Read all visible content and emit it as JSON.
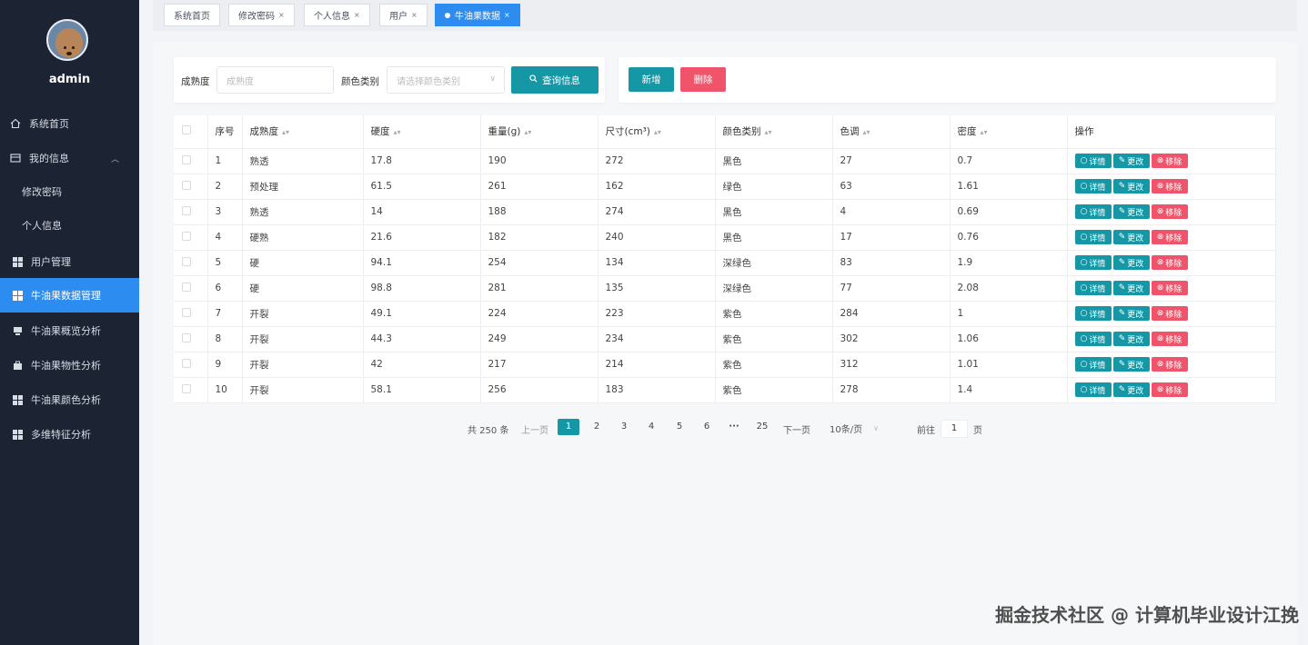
{
  "sidebar": {
    "username": "admin",
    "items": [
      {
        "label": "系统首页",
        "icon": "home-icon"
      },
      {
        "label": "我的信息",
        "icon": "profile-icon"
      },
      {
        "label": "修改密码"
      },
      {
        "label": "个人信息"
      },
      {
        "label": "用户管理",
        "icon": "grid-icon"
      },
      {
        "label": "牛油果数据管理",
        "icon": "grid-icon"
      },
      {
        "label": "牛油果概览分析",
        "icon": "chart-icon"
      },
      {
        "label": "牛油果物性分析",
        "icon": "briefcase-icon"
      },
      {
        "label": "牛油果颜色分析",
        "icon": "grid-icon"
      },
      {
        "label": "多维特征分析",
        "icon": "grid-icon"
      }
    ]
  },
  "tabs": [
    "系统首页",
    "修改密码",
    "个人信息",
    "用户",
    "牛油果数据"
  ],
  "search": {
    "ripeness_label": "成熟度",
    "ripeness_placeholder": "成熟度",
    "color_label": "颜色类别",
    "color_placeholder": "请选择颜色类别",
    "query_button": "查询信息"
  },
  "actions": {
    "add": "新增",
    "delete": "删除"
  },
  "table": {
    "headers": [
      "序号",
      "成熟度",
      "硬度",
      "重量(g)",
      "尺寸(cm³)",
      "颜色类别",
      "色调",
      "密度",
      "操作"
    ],
    "action_labels": {
      "view": "详情",
      "edit": "更改",
      "remove": "移除"
    },
    "rows": [
      [
        "1",
        "熟透",
        "17.8",
        "190",
        "272",
        "黑色",
        "27",
        "0.7"
      ],
      [
        "2",
        "预处理",
        "61.5",
        "261",
        "162",
        "绿色",
        "63",
        "1.61"
      ],
      [
        "3",
        "熟透",
        "14",
        "188",
        "274",
        "黑色",
        "4",
        "0.69"
      ],
      [
        "4",
        "硬熟",
        "21.6",
        "182",
        "240",
        "黑色",
        "17",
        "0.76"
      ],
      [
        "5",
        "硬",
        "94.1",
        "254",
        "134",
        "深绿色",
        "83",
        "1.9"
      ],
      [
        "6",
        "硬",
        "98.8",
        "281",
        "135",
        "深绿色",
        "77",
        "2.08"
      ],
      [
        "7",
        "开裂",
        "49.1",
        "224",
        "223",
        "紫色",
        "284",
        "1"
      ],
      [
        "8",
        "开裂",
        "44.3",
        "249",
        "234",
        "紫色",
        "302",
        "1.06"
      ],
      [
        "9",
        "开裂",
        "42",
        "217",
        "214",
        "紫色",
        "312",
        "1.01"
      ],
      [
        "10",
        "开裂",
        "58.1",
        "256",
        "183",
        "紫色",
        "278",
        "1.4"
      ]
    ]
  },
  "pagination": {
    "total": "共 250 条",
    "prev": "上一页",
    "pages": [
      "1",
      "2",
      "3",
      "4",
      "5",
      "6",
      "···",
      "25"
    ],
    "next": "下一页",
    "page_size": "10条/页",
    "goto_label": "前往",
    "goto_value": "1",
    "goto_suffix": "页"
  },
  "watermark": "掘金技术社区 @ 计算机毕业设计江挽"
}
